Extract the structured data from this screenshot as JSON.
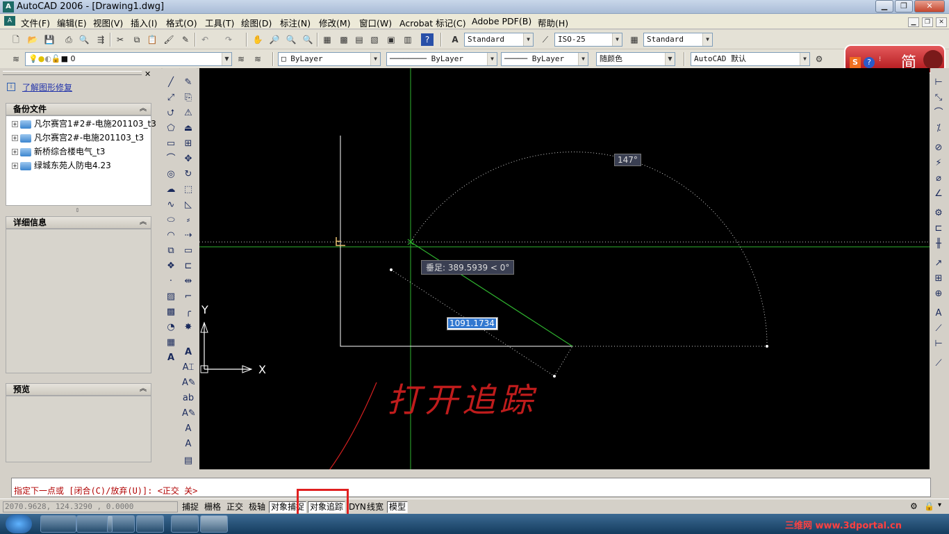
{
  "window": {
    "app_icon": "autocad-app-icon",
    "title": "AutoCAD 2006 - [Drawing1.dwg]",
    "buttons": [
      "minimize",
      "maximize",
      "close"
    ]
  },
  "menu": {
    "items": [
      "文件(F)",
      "编辑(E)",
      "视图(V)",
      "插入(I)",
      "格式(O)",
      "工具(T)",
      "绘图(D)",
      "标注(N)",
      "修改(M)",
      "窗口(W)",
      "Acrobat 标记(C)",
      "Adobe PDF(B)",
      "帮助(H)"
    ]
  },
  "toolbar1": {
    "text_style": "Standard",
    "dim_style": "ISO-25",
    "table_style": "Standard"
  },
  "toolbar2": {
    "layer": "0",
    "color": "ByLayer",
    "linetype": "ByLayer",
    "lineweight": "ByLayer",
    "plot_style": "随颜色",
    "workspace": "AutoCAD 默认"
  },
  "ime": {
    "mode": "简"
  },
  "leftpanel": {
    "link": "了解图形修复",
    "backup_header": "备份文件",
    "backup_files": [
      "凡尔赛宫1#2#-电施201103_t3",
      "凡尔赛宫2#-电施201103_t3",
      "新桥综合楼电气_t3",
      "绿城东苑人防电4.23"
    ],
    "details_header": "详细信息",
    "preview_header": "预览"
  },
  "canvas": {
    "angle_tooltip": "147°",
    "perp_tooltip": "垂足: 389.5939 < 0°",
    "length_input": "1091.1734",
    "axis_x": "X",
    "axis_y": "Y",
    "annotation": "打开追踪"
  },
  "command": {
    "prompt": "指定下一点或 [闭合(C)/放弃(U)]: <正交 关>"
  },
  "status": {
    "coords": "2070.9628, 124.3290 , 0.0000",
    "buttons": [
      {
        "label": "捕捉",
        "on": false
      },
      {
        "label": "栅格",
        "on": false
      },
      {
        "label": "正交",
        "on": false
      },
      {
        "label": "极轴",
        "on": false
      },
      {
        "label": "对象捕捉",
        "on": true
      },
      {
        "label": "对象追踪",
        "on": true
      },
      {
        "label": "DYN",
        "on": false
      },
      {
        "label": "线宽",
        "on": false
      },
      {
        "label": "模型",
        "on": true
      }
    ]
  },
  "taskbar": {
    "watermark": "三维网 www.3dportal.cn"
  },
  "colors": {
    "canvas_bg": "#000000",
    "tracking_green": "#2fb32f",
    "highlight_red": "#e02020",
    "command_text": "#b00000"
  }
}
